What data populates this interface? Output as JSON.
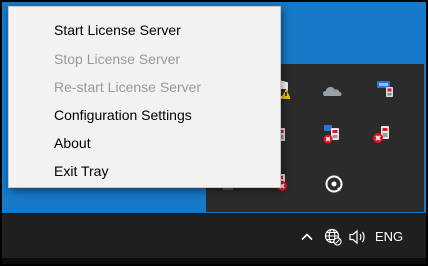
{
  "context_menu": {
    "items": [
      {
        "label": "Start License Server",
        "enabled": true
      },
      {
        "label": "Stop License Server",
        "enabled": false
      },
      {
        "label": "Re-start License Server",
        "enabled": false
      },
      {
        "label": "Configuration Settings",
        "enabled": true
      },
      {
        "label": "About",
        "enabled": true
      },
      {
        "label": "Exit Tray",
        "enabled": true
      }
    ]
  },
  "tray_overflow": {
    "icons": [
      "security-shield-warning-icon",
      "onedrive-cloud-icon",
      "network-device-icon",
      "license-error-icon",
      "license-error-icon",
      "license-error-icon",
      "license-server-icon",
      "license-error-icon",
      "media-disc-icon"
    ]
  },
  "taskbar": {
    "icons": [
      "chevron-up-icon",
      "globe-network-icon",
      "speaker-icon"
    ],
    "language": "ENG"
  },
  "colors": {
    "desktop": "#1679c9",
    "taskbar": "#1f1f1f",
    "tray_flyout": "#2b2b2b",
    "menu_background": "#f2f2f2",
    "disabled_text": "#9a9a9a",
    "error_badge": "#e81123"
  }
}
